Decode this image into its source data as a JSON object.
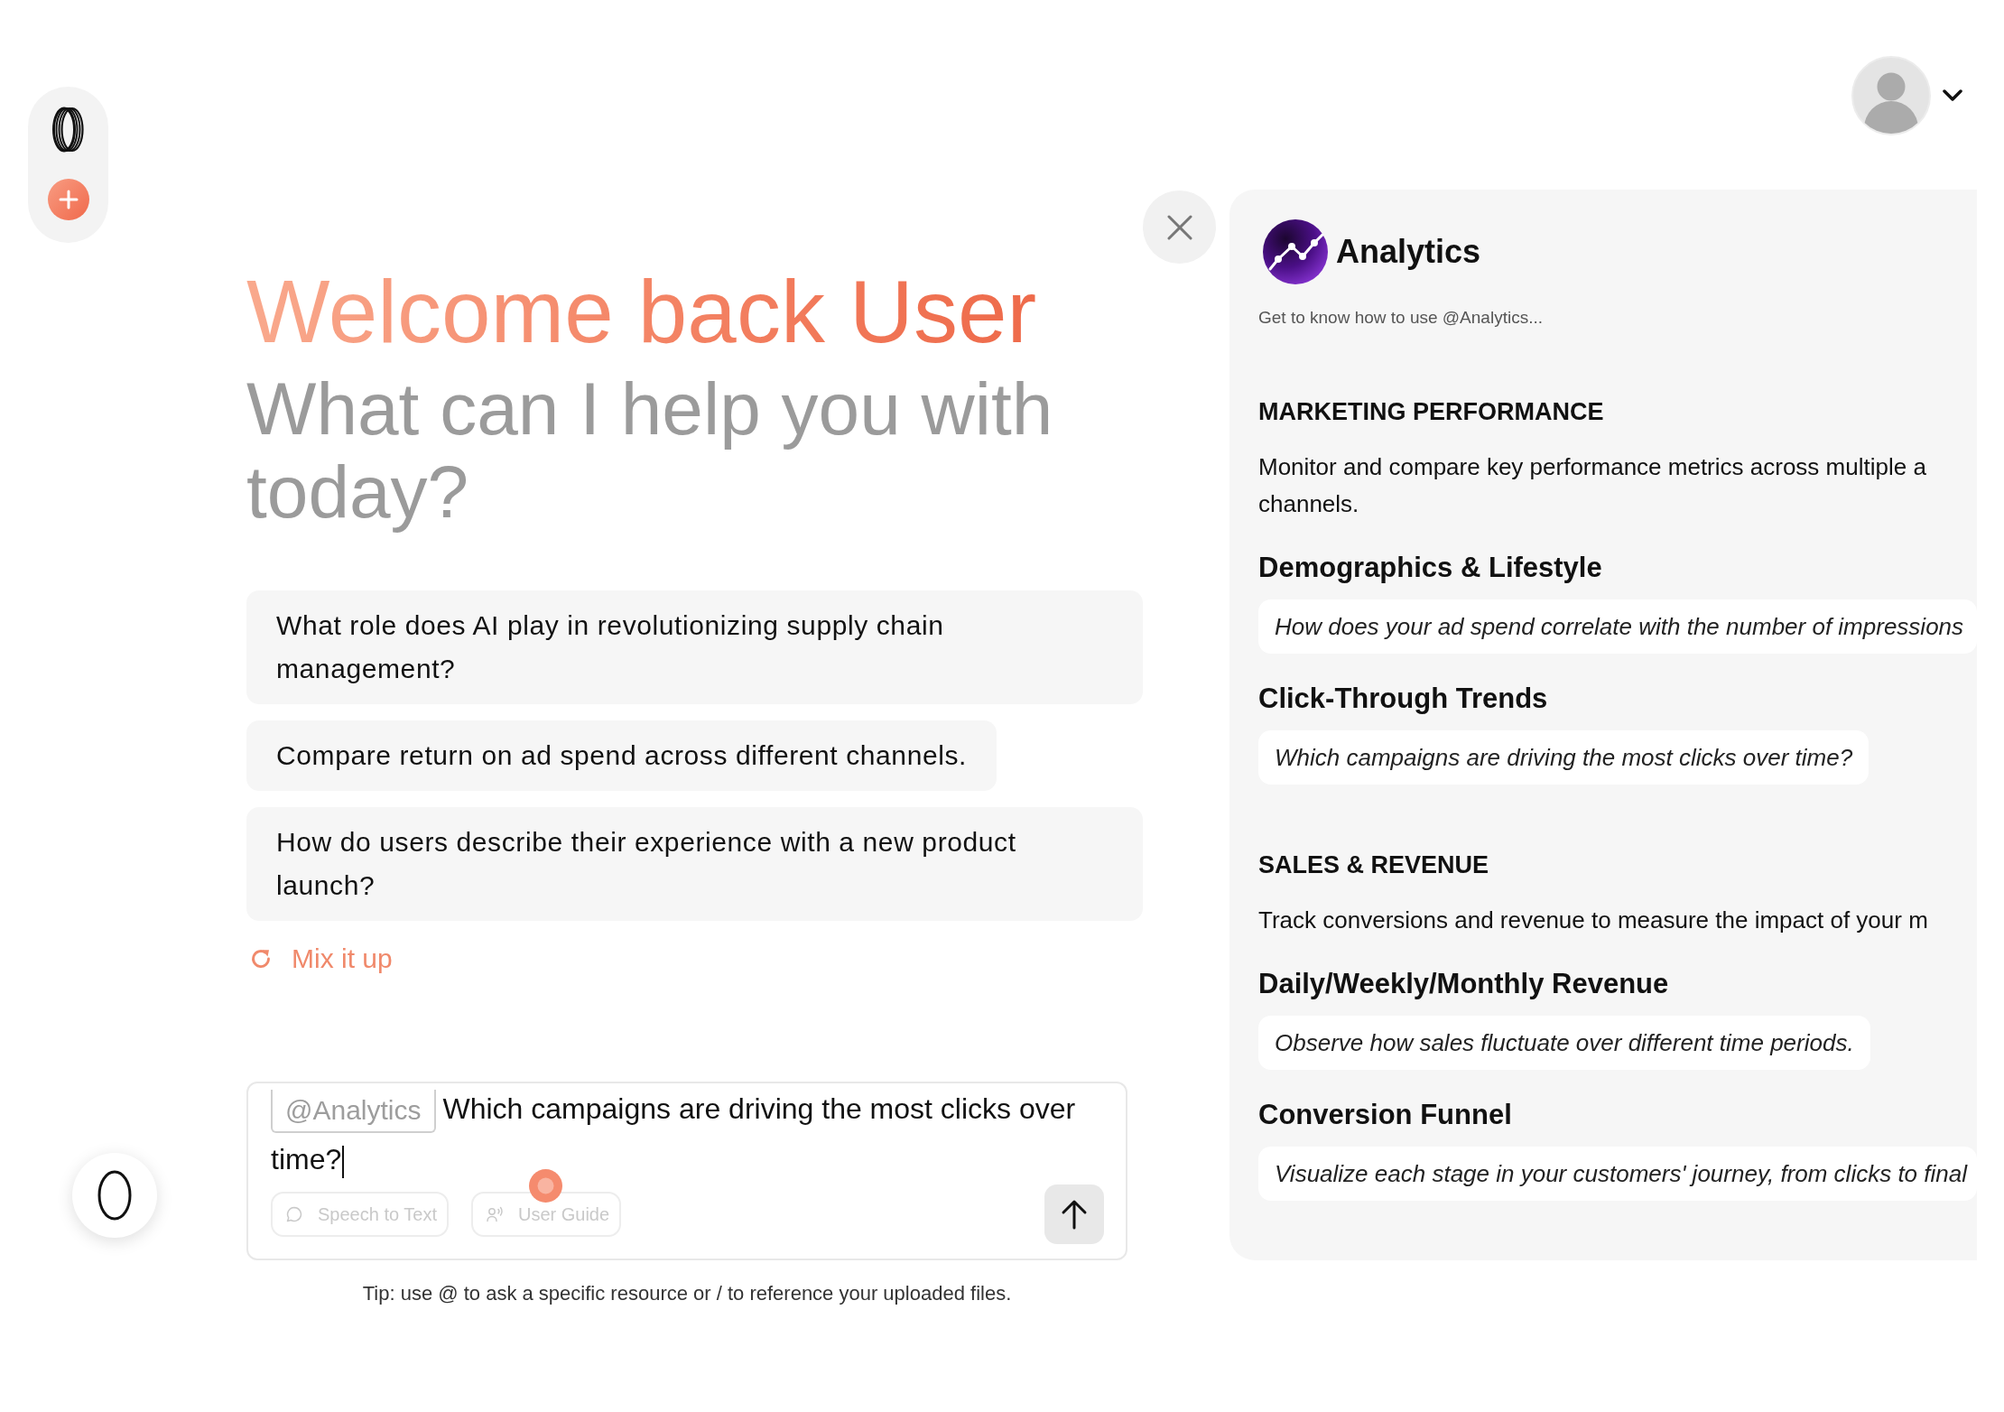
{
  "greeting": {
    "title": "Welcome back User",
    "subtitle": "What can I help you with today?"
  },
  "suggestions": [
    "What role does AI play in revolutionizing supply chain management?",
    "Compare return on ad spend across different channels.",
    "How do users describe their experience with a new product launch?"
  ],
  "mix_button": {
    "label": "Mix it up"
  },
  "composer": {
    "mention": "@Analytics",
    "value": "Which campaigns are driving the most clicks over time?",
    "tools": [
      {
        "kind": "speech",
        "label": "Speech to Text",
        "disabled": true
      },
      {
        "kind": "guide",
        "label": "User Guide",
        "disabled": true
      }
    ]
  },
  "tip": "Tip: use @ to ask a specific resource or / to reference your uploaded files.",
  "guide_panel": {
    "title": "Analytics",
    "subtitle": "Get to know how to use @Analytics...",
    "sections": [
      {
        "heading": "MARKETING PERFORMANCE",
        "description": "Monitor and compare key performance metrics across multiple a channels.",
        "topics": [
          {
            "title": "Demographics & Lifestyle",
            "example": "How does your ad spend correlate with the number of impressions"
          },
          {
            "title": "Click-Through Trends",
            "example": "Which campaigns are driving the most clicks over time?"
          }
        ]
      },
      {
        "heading": "SALES & REVENUE",
        "description": "Track conversions and revenue to measure the impact of your m",
        "topics": [
          {
            "title": "Daily/Weekly/Monthly Revenue",
            "example": "Observe how sales fluctuate over different time periods."
          },
          {
            "title": "Conversion Funnel",
            "example": "Visualize each stage in your customers' journey, from clicks to final"
          }
        ]
      }
    ]
  }
}
